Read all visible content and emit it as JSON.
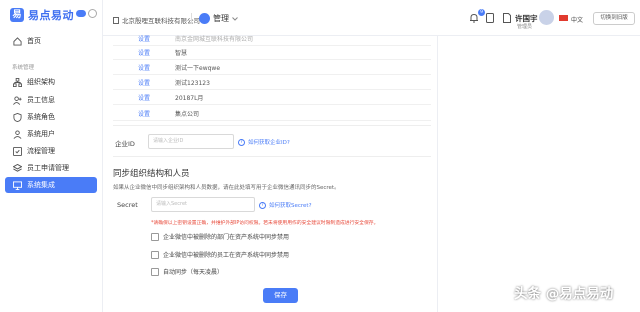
{
  "logo": {
    "mark": "易",
    "text": "易点易动"
  },
  "sidebar": {
    "section_label": "系统管理",
    "items": [
      {
        "label": "首页",
        "icon": "home-icon"
      },
      {
        "label": "组织架构",
        "icon": "org-icon"
      },
      {
        "label": "员工信息",
        "icon": "user-plus-icon"
      },
      {
        "label": "系统角色",
        "icon": "shield-icon"
      },
      {
        "label": "系统用户",
        "icon": "user-icon"
      },
      {
        "label": "流程管理",
        "icon": "flow-icon"
      },
      {
        "label": "员工申请管理",
        "icon": "stack-icon"
      },
      {
        "label": "系统集成",
        "icon": "monitor-icon"
      }
    ],
    "active_index": 7
  },
  "header": {
    "company": "北京殷哩互联科技有限公司",
    "management": "管理",
    "notification_count": "9",
    "user_name": "许国宇",
    "user_role": "管理员",
    "language": "中文",
    "switch_button": "切换到旧版"
  },
  "table": {
    "action_label": "设置",
    "rows": [
      "南京金网城互联科技有限公司",
      "智慧",
      "测试一下ewqwe",
      "测试123123",
      "20187L月",
      "集点公司"
    ]
  },
  "enterprise": {
    "label": "企业ID",
    "placeholder": "请输入企业ID",
    "help_link": "如何获取企业ID?"
  },
  "sync_section": {
    "title": "同步组织结构和人员",
    "description": "如果从企业微信中同步组织架构和人员数据，请在此处填写用于企业微信通讯同步的Secret。",
    "secret_label": "Secret",
    "secret_placeholder": "请输入Secret",
    "secret_help": "如何获取Secret?",
    "warning": "*请确保以上密钥设置正确，并维护外部IP访问权限。若未将使用用作的安全建议时限制造成进行安全保存。",
    "options": [
      "企业微信中被删除的部门在资产系统中同步禁用",
      "企业微信中被删除的员工在资产系统中同步禁用",
      "自动同步（每天凌晨）"
    ],
    "save_button": "保存"
  },
  "watermark": "头条 @易点易动",
  "colors": {
    "accent": "#4a7cf7",
    "warning": "#e84c3d"
  }
}
